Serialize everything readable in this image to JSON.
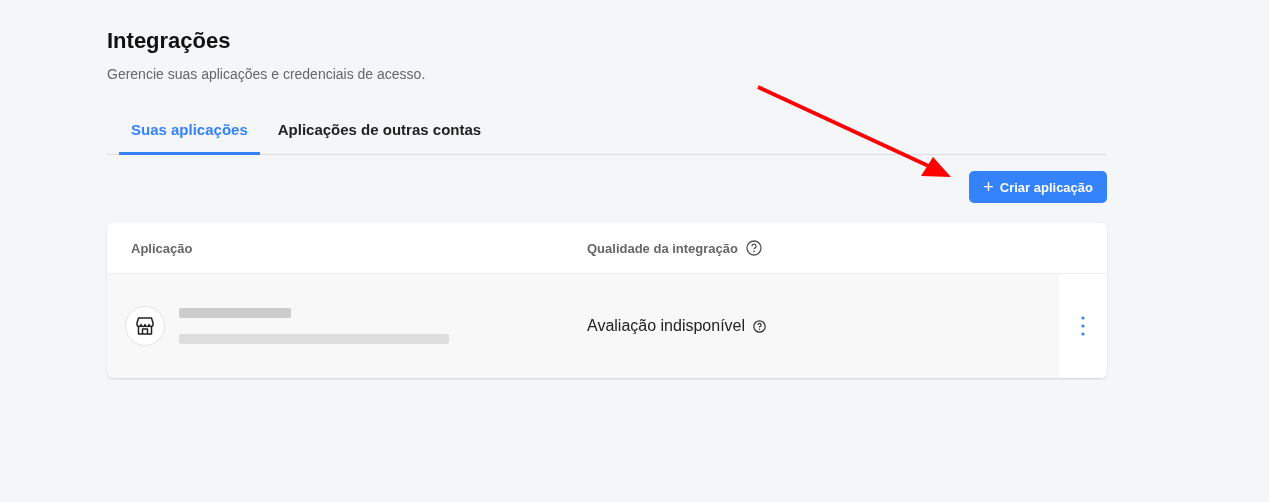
{
  "header": {
    "title": "Integrações",
    "subtitle": "Gerencie suas aplicações e credenciais de acesso."
  },
  "tabs": [
    {
      "label": "Suas aplicações",
      "selected": true
    },
    {
      "label": "Aplicações de outras contas",
      "selected": false
    }
  ],
  "create_button": {
    "icon": "+",
    "label": "Criar aplicação"
  },
  "table": {
    "columns": [
      {
        "label": "Aplicação",
        "help": false
      },
      {
        "label": "Qualidade da integração",
        "help": true
      }
    ],
    "rows": [
      {
        "name_redacted": true,
        "quality": "Avaliação indisponível",
        "quality_help": true
      }
    ]
  }
}
